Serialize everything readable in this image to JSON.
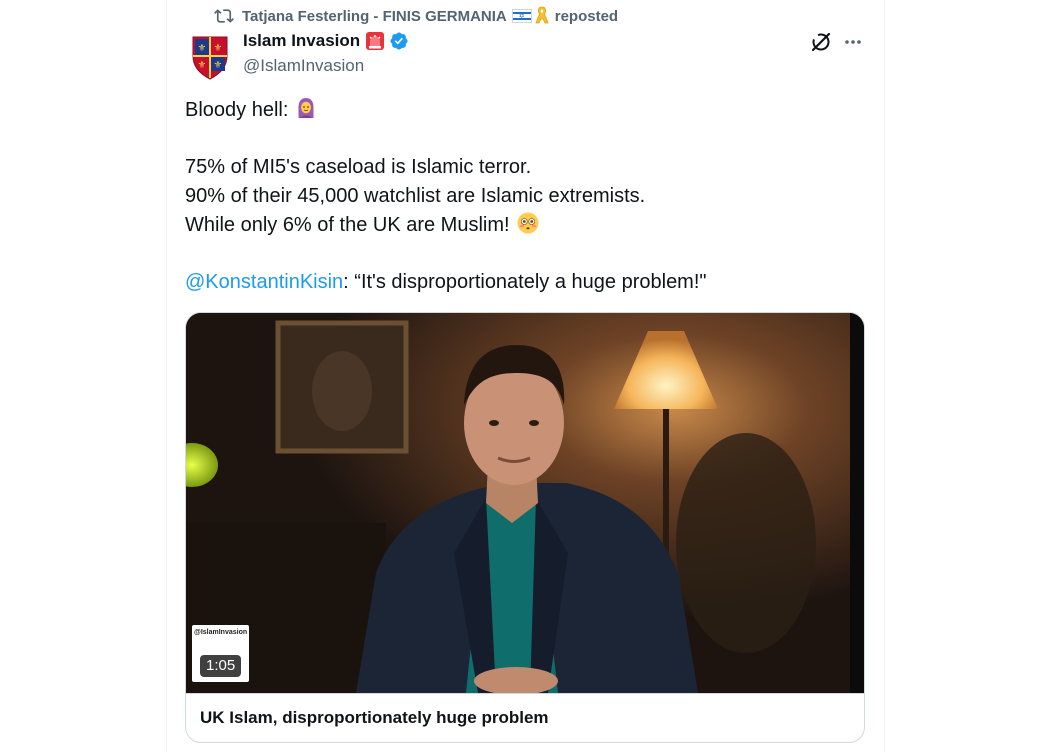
{
  "repost": {
    "user": "Tatjana Festerling - FINIS GERMANIA",
    "label": "reposted"
  },
  "author": {
    "display_name": "Islam Invasion",
    "handle": "@IslamInvasion"
  },
  "tweet": {
    "line1": "Bloody hell:",
    "line2": "75% of MI5's caseload is Islamic terror.",
    "line3": "90% of their 45,000 watchlist are Islamic extremists.",
    "line4": "While only 6% of the UK are Muslim!",
    "mention": "@KonstantinKisin",
    "quote": ": “It's disproportionately a huge problem!\""
  },
  "media": {
    "watermark_handle": "@IslamInvasion",
    "duration": "1:05",
    "card_title": "UK Islam, disproportionately huge problem"
  },
  "icons": {
    "repost": "repost-icon",
    "flag": "israel-flag-icon",
    "ribbon": "yellow-ribbon-icon",
    "siren": "siren-icon",
    "verified": "verified-badge-icon",
    "grok": "grok-icon",
    "more": "more-icon"
  },
  "colors": {
    "link": "#1d9bf0",
    "secondary_text": "#536471",
    "verified": "#1d9bf0"
  }
}
